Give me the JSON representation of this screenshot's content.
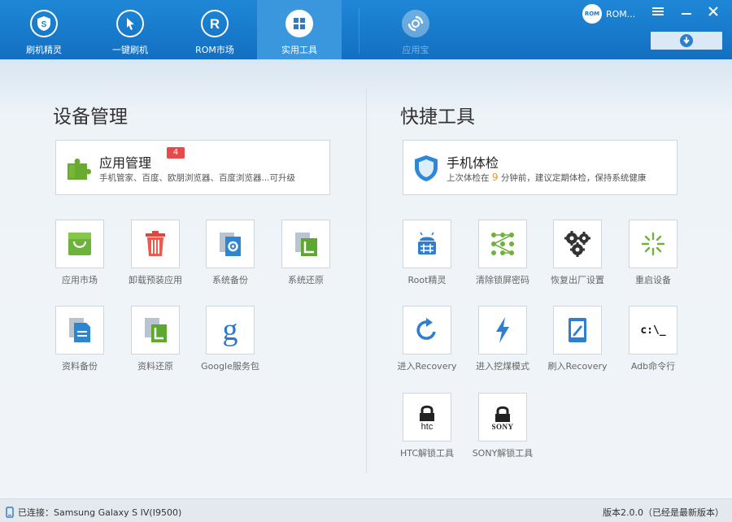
{
  "nav": {
    "items": [
      {
        "label": "刷机精灵",
        "icon": "shield-s-icon"
      },
      {
        "label": "一键刷机",
        "icon": "cursor-icon"
      },
      {
        "label": "ROM市场",
        "icon": "r-icon"
      },
      {
        "label": "实用工具",
        "icon": "grid-icon"
      }
    ],
    "active": "实用工具",
    "extra": {
      "label": "应用宝",
      "icon": "app-treasure-icon"
    }
  },
  "window": {
    "brand": "ROM...",
    "logo_text": "ROM",
    "menu_icon": "menu-icon",
    "minimize_icon": "minimize-icon",
    "close_icon": "close-icon",
    "download_icon": "download-icon"
  },
  "device": {
    "title": "设备管理",
    "card": {
      "title": "应用管理",
      "badge": "4",
      "subtitle": "手机管家、百度、欧朋浏览器、百度浏览器...可升级",
      "icon": "puzzle-icon"
    },
    "tools": [
      {
        "label": "应用市场",
        "icon": "shopping-bag-icon"
      },
      {
        "label": "卸载预装应用",
        "icon": "trash-icon"
      },
      {
        "label": "系统备份",
        "icon": "system-backup-icon"
      },
      {
        "label": "系统还原",
        "icon": "system-restore-icon"
      },
      {
        "label": "资料备份",
        "icon": "data-backup-icon"
      },
      {
        "label": "资料还原",
        "icon": "data-restore-icon"
      },
      {
        "label": "Google服务包",
        "icon": "google-icon"
      }
    ]
  },
  "quick": {
    "title": "快捷工具",
    "card": {
      "title": "手机体检",
      "subtitle_pre": "上次体检在",
      "subtitle_num": "9",
      "subtitle_post": "分钟前，建议定期体检，保持系统健康",
      "icon": "shield-check-icon"
    },
    "tools": [
      {
        "label": "Root精灵",
        "icon": "root-android-icon"
      },
      {
        "label": "清除锁屏密码",
        "icon": "pattern-lock-icon"
      },
      {
        "label": "恢复出厂设置",
        "icon": "gears-icon"
      },
      {
        "label": "重启设备",
        "icon": "reboot-spinner-icon"
      },
      {
        "label": "进入Recovery",
        "icon": "refresh-arrow-icon"
      },
      {
        "label": "进入挖煤模式",
        "icon": "lightning-icon"
      },
      {
        "label": "刷入Recovery",
        "icon": "tablet-pen-icon"
      },
      {
        "label": "Adb命令行",
        "icon": "terminal-icon",
        "glyph": "c:\\_"
      },
      {
        "label": "HTC解锁工具",
        "icon": "htc-lock-icon",
        "brand": "htc"
      },
      {
        "label": "SONY解锁工具",
        "icon": "sony-lock-icon",
        "brand": "SONY"
      }
    ]
  },
  "status": {
    "left": "已连接：Samsung Galaxy S IV(I9500)",
    "right": "版本2.0.0（已经是最新版本）",
    "icon": "phone-connected-icon"
  },
  "colors": {
    "topbar": "#1b7dcf",
    "active_tab": "#3b97dd",
    "badge": "#e84a4a",
    "accent_orange": "#e8962f"
  }
}
